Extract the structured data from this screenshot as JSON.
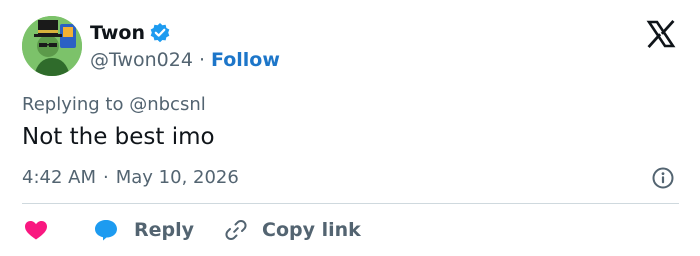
{
  "author": {
    "display_name": "Twon",
    "handle": "@Twon024",
    "separator": "·",
    "follow_label": "Follow",
    "verified": true
  },
  "reply_context": {
    "prefix": "Replying to",
    "mention": "@nbcsnl"
  },
  "tweet": {
    "text": "Not the best imo",
    "time": "4:42 AM",
    "separator": "·",
    "date": "May 10, 2026"
  },
  "actions": {
    "reply_label": "Reply",
    "copy_link_label": "Copy link"
  },
  "icons": {
    "logo": "x-logo-icon",
    "verified": "verified-badge-icon",
    "info": "info-icon",
    "like": "heart-icon",
    "reply": "speech-bubble-icon",
    "copy": "link-icon"
  },
  "colors": {
    "text_primary": "#0f1419",
    "text_secondary": "#536471",
    "link_blue": "#1d76c9",
    "verified_blue": "#1d9bf0",
    "heart_pink": "#f91880",
    "divider": "#cfd9de"
  }
}
